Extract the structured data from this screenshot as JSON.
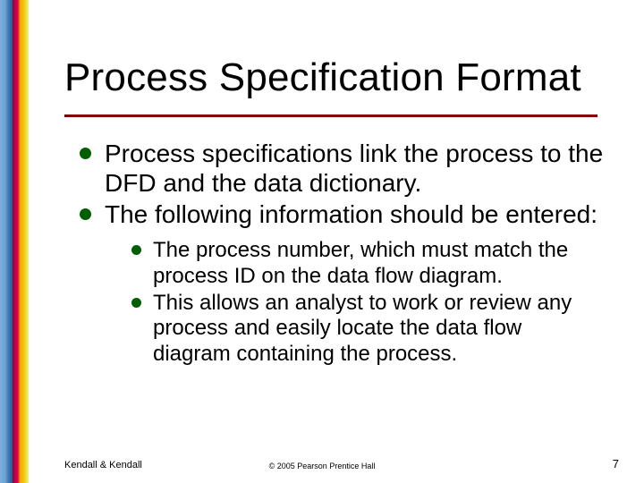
{
  "title": "Process Specification Format",
  "bullets": {
    "b1": "Process specifications link the process to the DFD and the data dictionary.",
    "b2": "The following information should be entered:",
    "sub1": "The process number, which must match the process ID on the data flow diagram.",
    "sub2": "This allows an analyst to work or review any process and easily locate the data flow diagram containing the process."
  },
  "footer": {
    "left": "Kendall & Kendall",
    "center": "© 2005 Pearson Prentice Hall",
    "page": "7"
  }
}
